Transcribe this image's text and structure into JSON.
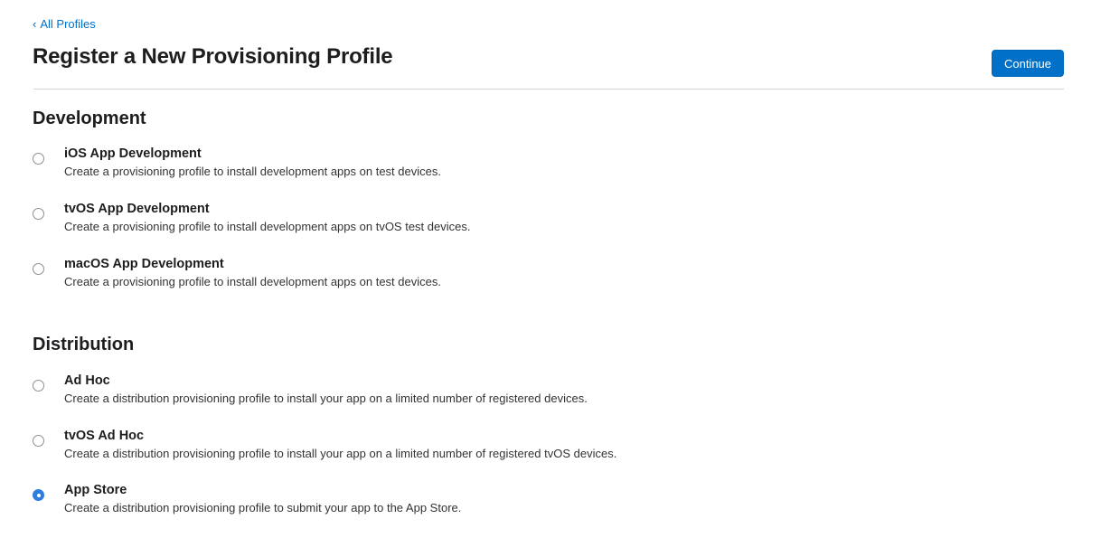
{
  "nav": {
    "back_label": "All Profiles"
  },
  "header": {
    "title": "Register a New Provisioning Profile",
    "continue_label": "Continue"
  },
  "sections": {
    "development": {
      "heading": "Development",
      "options": [
        {
          "title": "iOS App Development",
          "description": "Create a provisioning profile to install development apps on test devices.",
          "selected": false
        },
        {
          "title": "tvOS App Development",
          "description": "Create a provisioning profile to install development apps on tvOS test devices.",
          "selected": false
        },
        {
          "title": "macOS App Development",
          "description": "Create a provisioning profile to install development apps on test devices.",
          "selected": false
        }
      ]
    },
    "distribution": {
      "heading": "Distribution",
      "options": [
        {
          "title": "Ad Hoc",
          "description": "Create a distribution provisioning profile to install your app on a limited number of registered devices.",
          "selected": false
        },
        {
          "title": "tvOS Ad Hoc",
          "description": "Create a distribution provisioning profile to install your app on a limited number of registered tvOS devices.",
          "selected": false
        },
        {
          "title": "App Store",
          "description": "Create a distribution provisioning profile to submit your app to the App Store.",
          "selected": true
        }
      ]
    }
  },
  "colors": {
    "accent": "#0070c9",
    "radio_selected": "#2f7de1",
    "text": "#1d1d1f",
    "divider": "#d2d2d7"
  }
}
